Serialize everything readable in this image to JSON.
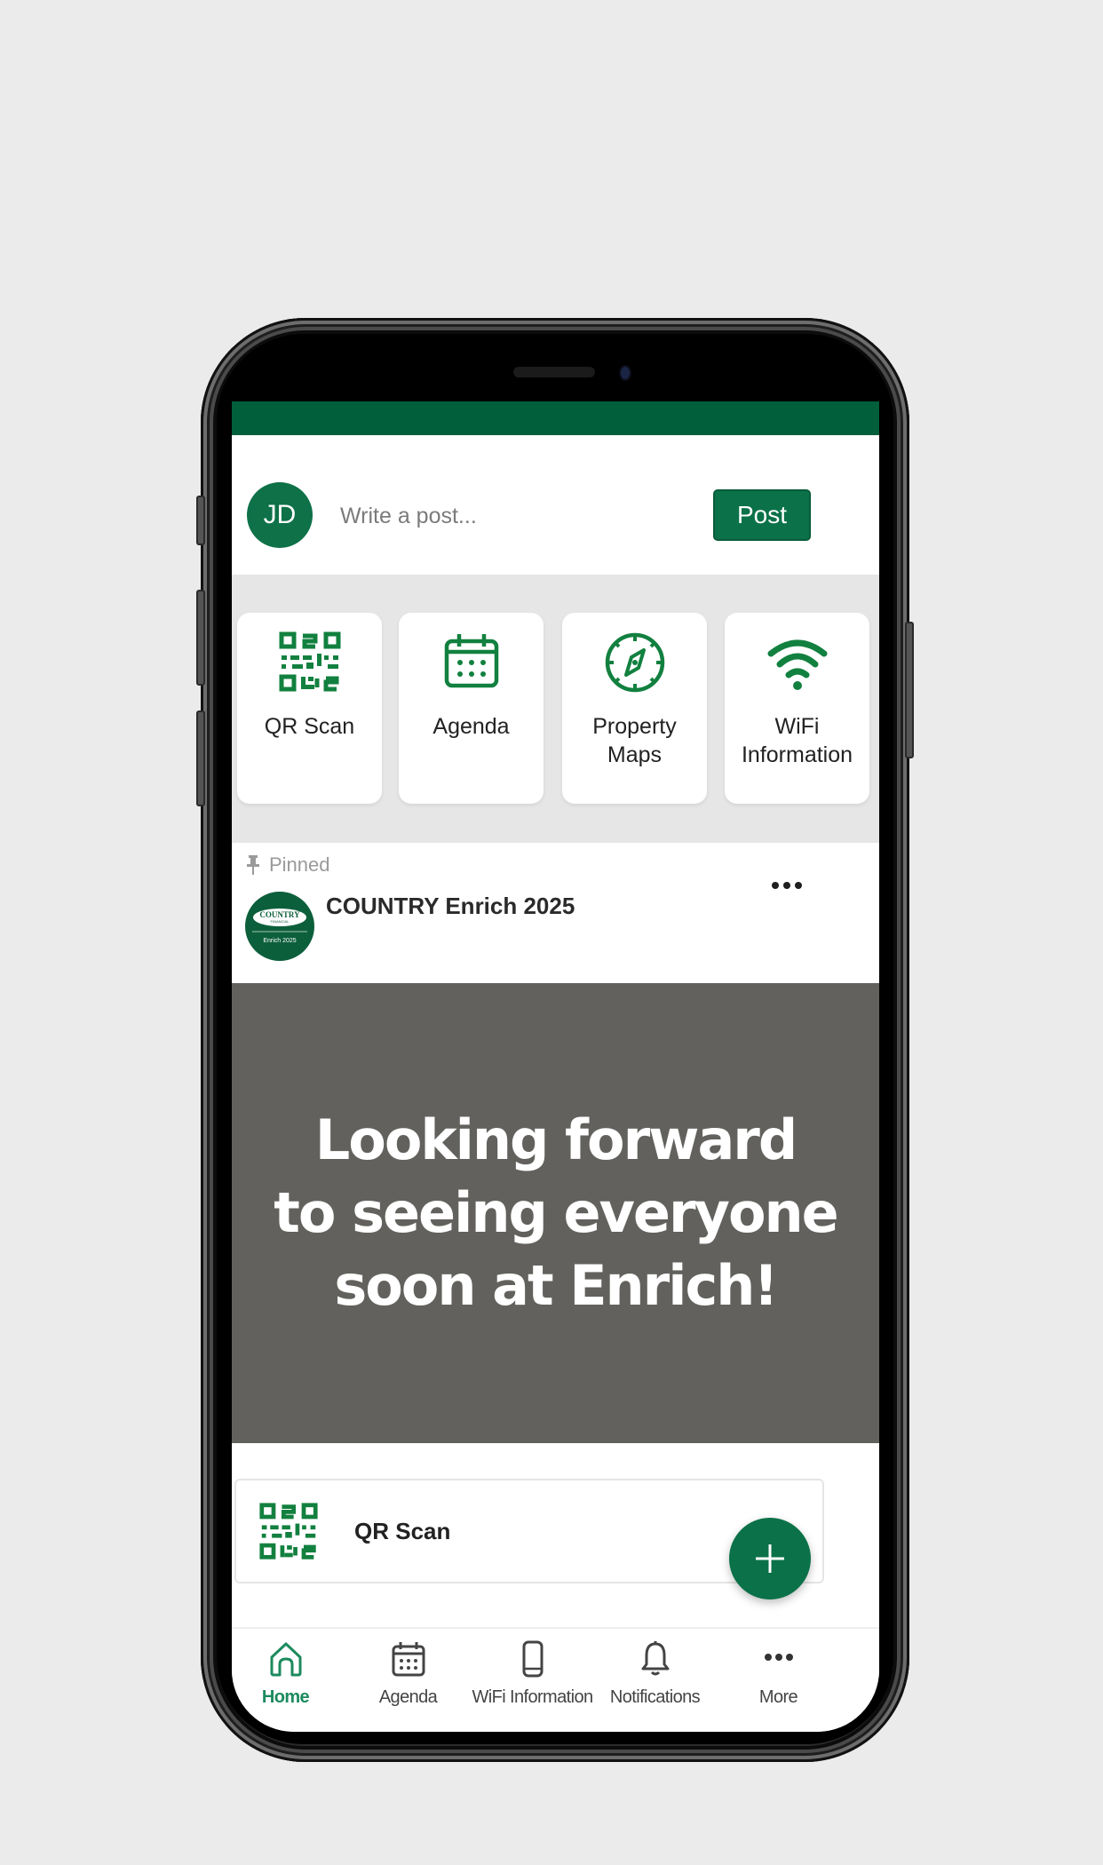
{
  "theme": {
    "brand_green": "#0b7148",
    "header_green": "#025f3c",
    "post_bg": "#62615d"
  },
  "composer": {
    "avatar_initials": "JD",
    "placeholder": "Write a post...",
    "post_label": "Post"
  },
  "quick_tiles": [
    {
      "label": "QR Scan",
      "icon": "qr-code-icon"
    },
    {
      "label": "Agenda",
      "icon": "calendar-icon"
    },
    {
      "label": "Property\nMaps",
      "icon": "compass-icon"
    },
    {
      "label": "WiFi\nInformation",
      "icon": "wifi-icon"
    }
  ],
  "pinned_post": {
    "pinned_label": "Pinned",
    "org_name": "COUNTRY Enrich 2025",
    "logo_text_top": "COUNTRY",
    "logo_text_sub": "FINANCIAL",
    "logo_text_bottom": "Enrich 2025",
    "body": "Looking forward\nto seeing everyone\nsoon at Enrich!"
  },
  "list_items": [
    {
      "label": "QR Scan",
      "icon": "qr-code-icon"
    }
  ],
  "fab": {
    "icon": "plus-icon"
  },
  "tabbar": {
    "tabs": [
      {
        "label": "Home",
        "icon": "home-icon",
        "active": true
      },
      {
        "label": "Agenda",
        "icon": "calendar-icon",
        "active": false
      },
      {
        "label": "WiFi Information",
        "icon": "phone-icon",
        "active": false
      },
      {
        "label": "Notifications",
        "icon": "bell-icon",
        "active": false
      },
      {
        "label": "More",
        "icon": "more-icon",
        "active": false
      }
    ]
  }
}
